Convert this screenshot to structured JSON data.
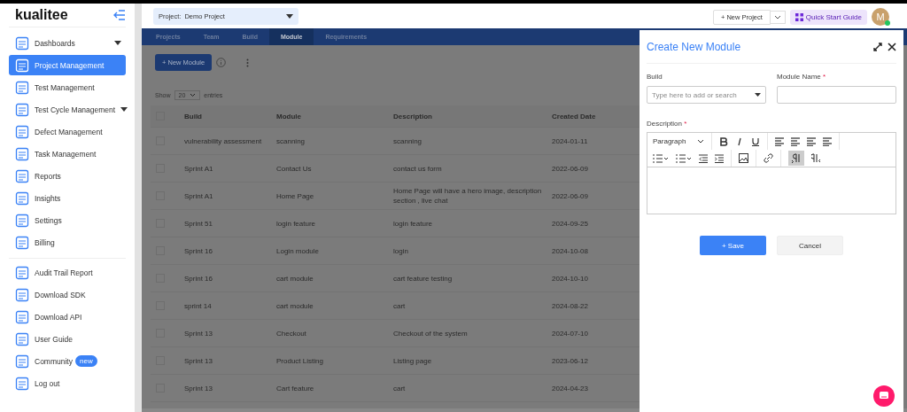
{
  "sidebar": {
    "logo": "kualitee",
    "items": [
      {
        "label": "Dashboards",
        "selected": false,
        "expandable": true
      },
      {
        "label": "Project Management",
        "selected": true,
        "expandable": false
      },
      {
        "label": "Test Management",
        "selected": false,
        "expandable": false
      },
      {
        "label": "Test Cycle Management",
        "selected": false,
        "expandable": true
      },
      {
        "label": "Defect Management",
        "selected": false,
        "expandable": false
      },
      {
        "label": "Task Management",
        "selected": false,
        "expandable": false
      },
      {
        "label": "Reports",
        "selected": false,
        "expandable": false
      },
      {
        "label": "Insights",
        "selected": false,
        "expandable": false
      },
      {
        "label": "Settings",
        "selected": false,
        "expandable": false
      },
      {
        "label": "Billing",
        "selected": false,
        "expandable": false
      }
    ],
    "bottom_items": [
      {
        "label": "Audit Trail Report",
        "selected": false
      },
      {
        "label": "Download SDK",
        "selected": false
      },
      {
        "label": "Download API",
        "selected": false
      },
      {
        "label": "User Guide",
        "selected": false
      },
      {
        "label": "Community",
        "selected": false,
        "badge": "new"
      },
      {
        "label": "Log out",
        "selected": false
      }
    ]
  },
  "topbar": {
    "project_label": "Project:",
    "project": "Demo Project",
    "new_project": "+ New Project",
    "quick_start": "Quick Start Guide",
    "avatar": "M"
  },
  "tabs": [
    {
      "label": "Projects",
      "selected": false
    },
    {
      "label": "Team",
      "selected": false
    },
    {
      "label": "Build",
      "selected": false
    },
    {
      "label": "Module",
      "selected": true
    },
    {
      "label": "Requirements",
      "selected": false
    }
  ],
  "new_module": "+ New Module",
  "show": {
    "before": "Show",
    "value": "20",
    "after": "entries"
  },
  "table": {
    "all_checked": false,
    "columns": [
      "Build",
      "Module",
      "Description",
      "Created Date"
    ],
    "rows": [
      {
        "checked": false,
        "cells": [
          "vulnerability assessment",
          "scanning",
          "scanning",
          "2024-01-11"
        ]
      },
      {
        "checked": false,
        "cells": [
          "Sprint A1",
          "Contact Us",
          "contact us form",
          "2022-06-09"
        ]
      },
      {
        "checked": false,
        "cells": [
          "Sprint A1",
          "Home Page",
          "Home Page will have a hero image, description section , live chat",
          "2022-06-09"
        ]
      },
      {
        "checked": false,
        "cells": [
          "Sprint 51",
          "login feature",
          "login feature",
          "2024-09-25"
        ]
      },
      {
        "checked": false,
        "cells": [
          "Sprint 16",
          "Login module",
          "login",
          "2024-10-08"
        ]
      },
      {
        "checked": false,
        "cells": [
          "Sprint 16",
          "cart module",
          "cart feature testing",
          "2024-10-10"
        ]
      },
      {
        "checked": false,
        "cells": [
          "sprint 14",
          "cart module",
          "cart",
          "2024-08-22"
        ]
      },
      {
        "checked": false,
        "cells": [
          "Sprint 13",
          "Checkout",
          "Checkout of the system",
          "2024-07-10"
        ]
      },
      {
        "checked": false,
        "cells": [
          "Sprint 13",
          "Product Listing",
          "Listing page",
          "2023-06-12"
        ]
      },
      {
        "checked": false,
        "cells": [
          "Sprint 13",
          "Cart feature",
          "cart",
          "2024-04-23"
        ]
      }
    ]
  },
  "drawer": {
    "title": "Create New Module",
    "build_label": "Build",
    "build_placeholder": "Type here to add or search",
    "name_label": "Module Name",
    "required_mark": "*",
    "description_label": "Description",
    "paragraph": "Paragraph",
    "save": "+ Save",
    "cancel": "Cancel"
  }
}
